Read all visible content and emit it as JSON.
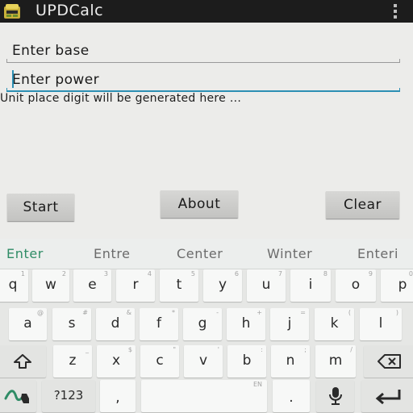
{
  "app": {
    "title": "UPDCalc",
    "icon": "app-icon"
  },
  "form": {
    "base_placeholder": "Enter base",
    "power_placeholder": "Enter power",
    "result_text": "Unit place digit will be generated here ..."
  },
  "buttons": {
    "start": "Start",
    "about": "About",
    "clear": "Clear"
  },
  "keyboard": {
    "suggestions": [
      "Enter",
      "Entre",
      "Center",
      "Winter",
      "Enteri"
    ],
    "row1": [
      {
        "main": "q",
        "hint": "1"
      },
      {
        "main": "w",
        "hint": "2"
      },
      {
        "main": "e",
        "hint": "3"
      },
      {
        "main": "r",
        "hint": "4"
      },
      {
        "main": "t",
        "hint": "5"
      },
      {
        "main": "y",
        "hint": "6"
      },
      {
        "main": "u",
        "hint": "7"
      },
      {
        "main": "i",
        "hint": "8"
      },
      {
        "main": "o",
        "hint": "9"
      },
      {
        "main": "p",
        "hint": "0"
      }
    ],
    "row2": [
      {
        "main": "a",
        "hint": "@"
      },
      {
        "main": "s",
        "hint": "#"
      },
      {
        "main": "d",
        "hint": "&"
      },
      {
        "main": "f",
        "hint": "*"
      },
      {
        "main": "g",
        "hint": "-"
      },
      {
        "main": "h",
        "hint": "+"
      },
      {
        "main": "j",
        "hint": "="
      },
      {
        "main": "k",
        "hint": "("
      },
      {
        "main": "l",
        "hint": ")"
      }
    ],
    "row3": [
      {
        "main": "z",
        "hint": "_"
      },
      {
        "main": "x",
        "hint": "$"
      },
      {
        "main": "c",
        "hint": "\""
      },
      {
        "main": "v",
        "hint": "'"
      },
      {
        "main": "b",
        "hint": ":"
      },
      {
        "main": "n",
        "hint": ";"
      },
      {
        "main": "m",
        "hint": "/"
      }
    ],
    "symbols_label": "?123",
    "comma": ",",
    "space_hint": "EN",
    "period": ".",
    "shift_icon": "shift-icon",
    "backspace_icon": "backspace-icon",
    "gesture_icon": "gesture-typing-icon",
    "mic_icon": "microphone-icon",
    "enter_icon": "enter-icon"
  }
}
